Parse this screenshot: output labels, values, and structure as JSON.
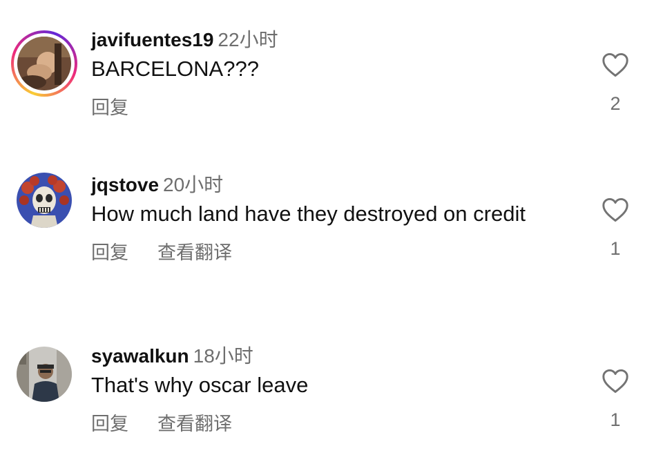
{
  "comments": [
    {
      "username": "javifuentes19",
      "time": "22小时",
      "text": "BARCELONA???",
      "actions": [
        "回复"
      ],
      "likes": "2",
      "avatar": "user-photo-with-story-ring"
    },
    {
      "username": "jqstove",
      "time": "20小时",
      "text": "How much land have they destroyed on credit",
      "actions": [
        "回复",
        "查看翻译"
      ],
      "likes": "1",
      "avatar": "skull-and-roses-art"
    },
    {
      "username": "syawalkun",
      "time": "18小时",
      "text": "That's why oscar leave",
      "actions": [
        "回复",
        "查看翻译"
      ],
      "likes": "1",
      "avatar": "user-photo-street"
    }
  ],
  "colors": {
    "text": "#111111",
    "muted": "#6e6e6e",
    "story_ring": [
      "#f9ce34",
      "#ee2a7b",
      "#6228d7"
    ]
  },
  "icons": {
    "like": "heart-outline-icon"
  }
}
